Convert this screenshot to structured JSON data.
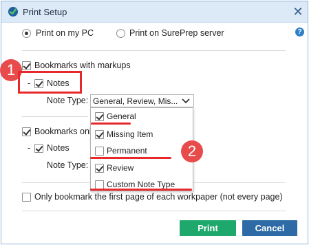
{
  "window": {
    "title": "Print Setup",
    "close_glyph": "✕",
    "help_glyph": "?"
  },
  "print_target": {
    "option_pc": "Print on my PC",
    "option_server": "Print on SurePrep server",
    "selected": "Print on my PC"
  },
  "section1": {
    "bookmarks_label": "Bookmarks with markups",
    "bookmarks_checked": true,
    "dash": "-",
    "notes_label": "Notes",
    "notes_checked": true,
    "note_type_label": "Note Type:",
    "note_type_value": "General, Review, Mis..."
  },
  "dropdown": {
    "items": [
      {
        "label": "General",
        "checked": true
      },
      {
        "label": "Missing Item",
        "checked": true
      },
      {
        "label": "Permanent",
        "checked": false
      },
      {
        "label": "Review",
        "checked": true
      },
      {
        "label": "Custom Note Type",
        "checked": false
      }
    ]
  },
  "section2": {
    "bookmarks_label": "Bookmarks onl",
    "bookmarks_checked": true,
    "dash": "-",
    "notes_label": "Notes",
    "notes_checked": true,
    "note_type_label": "Note Type:"
  },
  "only_first_page": {
    "label": "Only bookmark the first page of each workpaper (not every page)",
    "checked": false
  },
  "buttons": {
    "print": "Print",
    "cancel": "Cancel"
  },
  "annotations": {
    "badge1": "1",
    "badge2": "2",
    "color": "#e8292b"
  },
  "colors": {
    "print_button": "#1fa86b",
    "cancel_button": "#2d6aa6",
    "titlebar": "#dce9f7"
  }
}
